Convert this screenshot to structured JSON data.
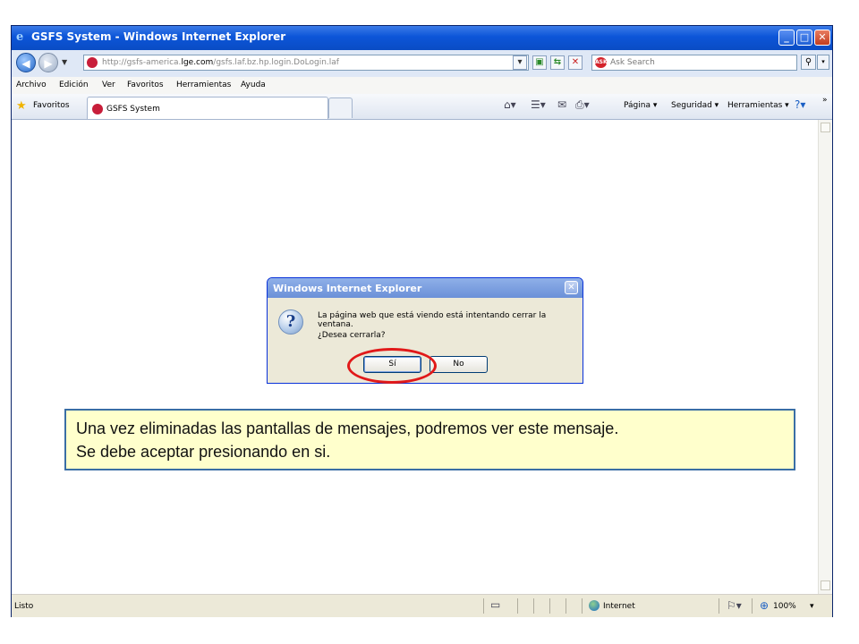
{
  "window": {
    "title": "GSFS System - Windows Internet Explorer",
    "minimize": "_",
    "maximize": "□",
    "close": "✕"
  },
  "address": {
    "url_prefix": "http://gsfs-america.",
    "url_domain": "lge.com",
    "url_suffix": "/gsfs.laf.bz.hp.login.DoLogin.laf",
    "search_placeholder": "Ask Search",
    "search_logo": "ASK"
  },
  "menu": {
    "items": [
      "Archivo",
      "Edición",
      "Ver",
      "Favoritos",
      "Herramientas",
      "Ayuda"
    ]
  },
  "favbar": {
    "favorites_label": "Favoritos",
    "tab_label": "GSFS System",
    "page_label": "Página ▾",
    "security_label": "Seguridad ▾",
    "tools_label": "Herramientas ▾",
    "more": "»"
  },
  "dialog": {
    "title": "Windows Internet Explorer",
    "message": "La página web que está viendo está intentando cerrar la ventana.",
    "question": "¿Desea cerrarla?",
    "yes_label": "Sí",
    "no_label": "No"
  },
  "callout": {
    "line1": "Una vez eliminadas las pantallas de mensajes, podremos ver este mensaje.",
    "line2": "Se debe aceptar presionando en si."
  },
  "status": {
    "text": "Listo",
    "zone": "Internet",
    "zoom": "100%"
  },
  "colors": {
    "titlebar": "#0c55d8",
    "highlight": "#e11919",
    "callout_bg": "#ffffcc",
    "callout_border": "#3a6ea5"
  }
}
